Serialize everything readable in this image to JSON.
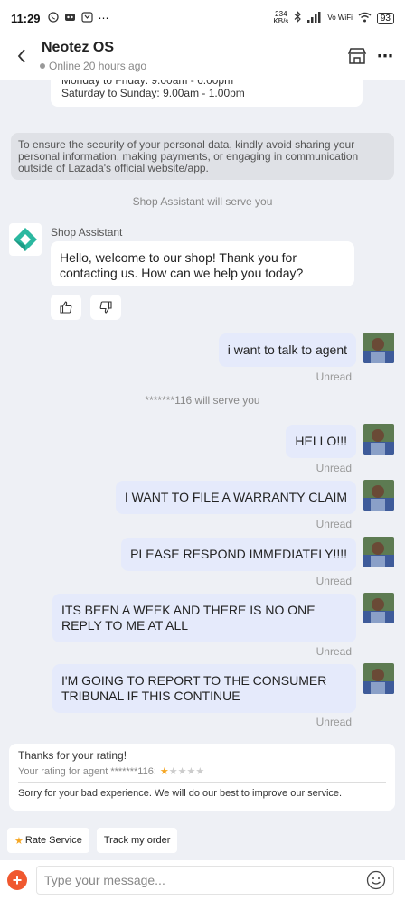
{
  "status_bar": {
    "time": "11:29",
    "network_speed_value": "234",
    "network_speed_unit": "KB/s",
    "wifi_label": "Vo WiFi",
    "battery": "93"
  },
  "header": {
    "title": "Neotez OS",
    "presence": "Online 20 hours ago"
  },
  "store_hours": {
    "weekday": "Monday to Friday: 9.00am - 6.00pm",
    "weekend": "Saturday to Sunday: 9.00am - 1.00pm"
  },
  "security_notice": "To ensure the security of your personal data,  kindly avoid sharing your personal information, making payments, or engaging in communication outside of Lazada's official website/app.",
  "system_messages": {
    "assistant_serve": "Shop Assistant will serve you",
    "agent_serve": "*******116 will serve you"
  },
  "assistant": {
    "name": "Shop Assistant",
    "greeting": "Hello, welcome to our shop! Thank you for contacting us. How can we help you today?"
  },
  "messages": [
    {
      "text": "i want to talk to agent",
      "status": "Unread"
    },
    {
      "text": "HELLO!!!",
      "status": "Unread"
    },
    {
      "text": "I WANT TO FILE A WARRANTY CLAIM",
      "status": "Unread"
    },
    {
      "text": "PLEASE RESPOND IMMEDIATELY!!!!",
      "status": "Unread"
    },
    {
      "text": "ITS BEEN A WEEK AND THERE IS NO ONE REPLY TO ME AT ALL",
      "status": "Unread"
    },
    {
      "text": "I'M GOING TO REPORT TO THE CONSUMER TRIBUNAL IF THIS CONTINUE",
      "status": "Unread"
    }
  ],
  "rating_card": {
    "thanks": "Thanks for your rating!",
    "rating_label": "Your rating for agent *******116:",
    "rating_value": 1,
    "rating_max": 5,
    "apology": "Sorry for your bad experience. We will do our best to improve our service."
  },
  "quick_actions": {
    "rate_service": "Rate Service",
    "track_order": "Track my order"
  },
  "composer": {
    "placeholder": "Type your message..."
  },
  "colors": {
    "accent": "#f0582f",
    "bubble_self": "#e5eafb",
    "star": "#f5a623"
  }
}
